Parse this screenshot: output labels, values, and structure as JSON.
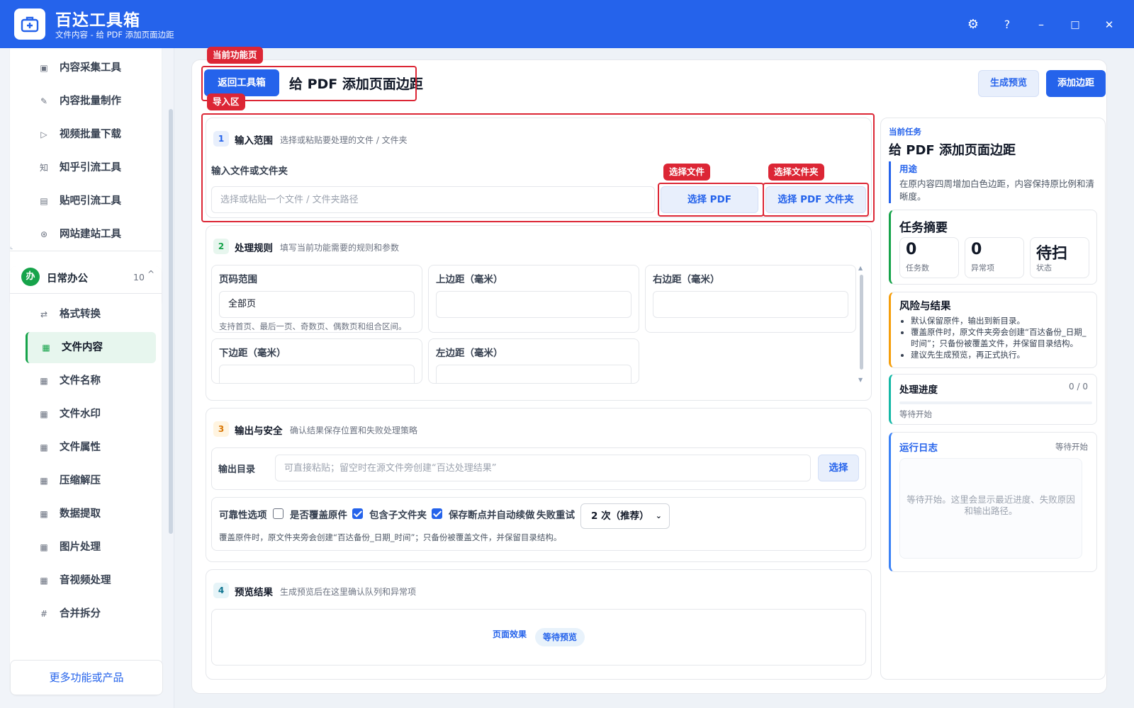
{
  "app": {
    "title": "百达工具箱",
    "subtitle": "文件内容 - 给 PDF 添加页面边距"
  },
  "window_controls": {
    "settings": "⚙",
    "help": "?",
    "minimize": "–",
    "maximize": "□",
    "close": "✕"
  },
  "sidebar": {
    "top_items": [
      {
        "icon": "▣",
        "label": "内容采集工具"
      },
      {
        "icon": "✎",
        "label": "内容批量制作"
      },
      {
        "icon": "▷",
        "label": "视频批量下载"
      },
      {
        "icon": "知",
        "label": "知乎引流工具"
      },
      {
        "icon": "▤",
        "label": "贴吧引流工具"
      },
      {
        "icon": "⊛",
        "label": "网站建站工具"
      }
    ],
    "group": {
      "badge": "办",
      "name": "日常办公",
      "count": "10",
      "caret": "^"
    },
    "group_items": [
      {
        "icon": "⇄",
        "label": "格式转换"
      },
      {
        "icon": "▦",
        "label": "文件内容"
      },
      {
        "icon": "▦",
        "label": "文件名称"
      },
      {
        "icon": "▦",
        "label": "文件水印"
      },
      {
        "icon": "▦",
        "label": "文件属性"
      },
      {
        "icon": "▦",
        "label": "压缩解压"
      },
      {
        "icon": "▦",
        "label": "数据提取"
      },
      {
        "icon": "▦",
        "label": "图片处理"
      },
      {
        "icon": "▦",
        "label": "音视频处理"
      },
      {
        "icon": "#",
        "label": "合并拆分"
      }
    ],
    "active_label": "文件内容",
    "more": "更多功能或产品"
  },
  "header": {
    "back_button": "返回工具箱",
    "page_title": "给 PDF 添加页面边距",
    "preview_button": "生成预览",
    "add_button": "添加边距"
  },
  "annotations": {
    "current_page": "当前功能页",
    "import_area": "导入区",
    "choose_file": "选择文件",
    "choose_folder": "选择文件夹"
  },
  "section1": {
    "num": "1",
    "title": "输入范围",
    "desc": "选择或粘贴要处理的文件 / 文件夹",
    "field_label": "输入文件或文件夹",
    "placeholder": "选择或粘贴一个文件 / 文件夹路径",
    "value": "",
    "btn_pdf": "选择 PDF",
    "btn_folder": "选择 PDF 文件夹"
  },
  "section2": {
    "num": "2",
    "title": "处理规则",
    "desc": "填写当前功能需要的规则和参数",
    "page_range_label": "页码范围",
    "page_range_value": "全部页",
    "page_range_hint": "支持首页、最后一页、奇数页、偶数页和组合区间。",
    "top_label": "上边距（毫米）",
    "top_value": "",
    "right_label": "右边距（毫米）",
    "right_value": "",
    "bottom_label": "下边距（毫米）",
    "bottom_value": "",
    "left_label": "左边距（毫米）",
    "left_value": ""
  },
  "section3": {
    "num": "3",
    "title": "输出与安全",
    "desc": "确认结果保存位置和失败处理策略",
    "output_label": "输出目录",
    "output_placeholder": "可直接粘贴；留空时在源文件旁创建“百达处理结果”",
    "output_value": "",
    "output_button": "选择",
    "reliability_label": "可靠性选项",
    "overwrite_label": "是否覆盖原件",
    "overwrite_checked": false,
    "subfolder_label": "包含子文件夹",
    "subfolder_checked": true,
    "resume_label": "保存断点并自动续做",
    "resume_checked": true,
    "retry_label": "失败重试",
    "retry_value": "2 次（推荐）",
    "note": "覆盖原件时，原文件夹旁会创建“百达备份_日期_时间”；只备份被覆盖文件，并保留目录结构。"
  },
  "section4": {
    "num": "4",
    "title": "预览结果",
    "desc": "生成预览后在这里确认队列和异常项",
    "preview_label": "页面效果",
    "preview_status": "等待预览"
  },
  "right_panel": {
    "task_small": "当前任务",
    "task_title": "给 PDF 添加页面边距",
    "purpose_title": "用途",
    "purpose_desc": "在原内容四周增加白色边距，内容保持原比例和清晰度。",
    "summary_title": "任务摘要",
    "stats": [
      {
        "value": "0",
        "label": "任务数"
      },
      {
        "value": "0",
        "label": "异常项"
      },
      {
        "value": "待扫",
        "label": "状态"
      }
    ],
    "risk_title": "风险与结果",
    "risks": [
      "默认保留原件，输出到新目录。",
      "覆盖原件时，原文件夹旁会创建“百达备份_日期_时间”；只备份被覆盖文件，并保留目录结构。",
      "建议先生成预览，再正式执行。"
    ],
    "progress_title": "处理进度",
    "progress_count": "0 / 0",
    "progress_fraction": 0,
    "progress_status": "等待开始",
    "log_title": "运行日志",
    "log_status": "等待开始",
    "log_text": "等待开始。这里会显示最近进度、失败原因和输出路径。"
  },
  "colors": {
    "brand": "#2563eb",
    "annotation": "#dc2635",
    "active_green": "#16a34a"
  }
}
